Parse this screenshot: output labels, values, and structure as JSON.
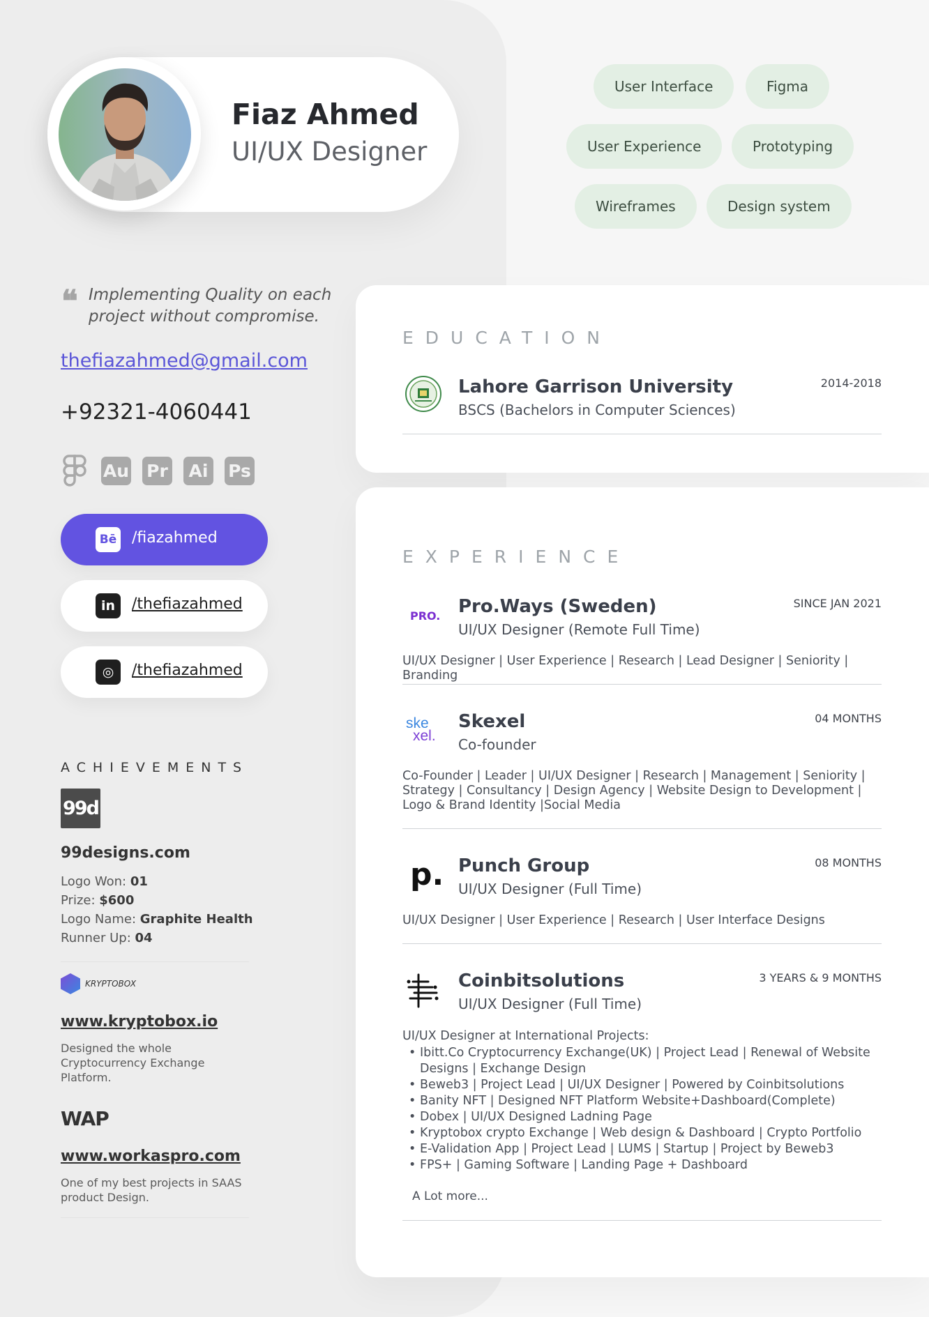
{
  "profile": {
    "name": "Fiaz Ahmed",
    "title": "UI/UX Designer",
    "quote": "Implementing Quality on each project without compromise.",
    "email": "thefiazahmed@gmail.com",
    "phone": "+92321-4060441"
  },
  "skills": [
    "User Interface",
    "Figma",
    "User Experience",
    "Prototyping",
    "Wireframes",
    "Design system"
  ],
  "tools": [
    {
      "icon": "figma-icon",
      "label": ""
    },
    {
      "icon": "audition-icon",
      "label": "Au"
    },
    {
      "icon": "premiere-icon",
      "label": "Pr"
    },
    {
      "icon": "illustrator-icon",
      "label": "Ai"
    },
    {
      "icon": "photoshop-icon",
      "label": "Ps"
    }
  ],
  "social": [
    {
      "icon": "behance-icon",
      "glyph": "Bē",
      "label": "/fiazahmed"
    },
    {
      "icon": "linkedin-icon",
      "glyph": "in",
      "label": "/thefiazahmed"
    },
    {
      "icon": "instagram-icon",
      "glyph": "◎",
      "label": "/thefiazahmed"
    }
  ],
  "achievements": {
    "title": "ACHIEVEMENTS",
    "designs99": {
      "logo_text": "99d",
      "site": "99designs.com",
      "lines": [
        {
          "label": "Logo Won: ",
          "value": "01"
        },
        {
          "label": "Prize: ",
          "value": "$600"
        },
        {
          "label": "Logo Name: ",
          "value": "Graphite Health"
        },
        {
          "label": "Runner Up: ",
          "value": "04"
        }
      ]
    },
    "kryptobox": {
      "logo_text": "KRYPTOBOX",
      "site": "www.kryptobox.io",
      "desc": "Designed the whole Cryptocurrency Exchange Platform."
    },
    "workaspro": {
      "logo_text": "WAP",
      "site": "www.workaspro.com",
      "desc": "One of my best projects in SAAS product Design."
    }
  },
  "education": {
    "title": "EDUCATION",
    "school": "Lahore Garrison University",
    "degree": "BSCS (Bachelors in Computer Sciences)",
    "years": "2014-2018"
  },
  "experience": {
    "title": "EXPERIENCE",
    "entries": [
      {
        "logo": "PRO.",
        "company": "Pro.Ways (Sweden)",
        "role": "UI/UX Designer (Remote Full Time)",
        "duration": "SINCE JAN 2021",
        "desc": "UI/UX Designer | User Experience | Research | Lead Designer | Seniority | Branding"
      },
      {
        "logo": "ske xel.",
        "company": "Skexel",
        "role": "Co-founder",
        "duration": "04 MONTHS",
        "desc": "Co-Founder | Leader | UI/UX Designer | Research | Management | Seniority | Strategy | Consultancy | Design Agency | Website Design to Development | Logo & Brand Identity |Social Media"
      },
      {
        "logo": "p.",
        "company": "Punch Group",
        "role": "UI/UX Designer (Full Time)",
        "duration": "08 MONTHS",
        "desc": "UI/UX Designer | User Experience | Research | User Interface Designs"
      },
      {
        "logo": "coinbit",
        "company": "Coinbitsolutions",
        "role": "UI/UX Designer (Full Time)",
        "duration": "3 YEARS & 9 MONTHS",
        "intro": "UI/UX Designer at International Projects:",
        "bullets": [
          "Ibitt.Co Cryptocurrency Exchange(UK) | Project Lead | Renewal of Website Designs | Exchange Design",
          "Beweb3 | Project Lead | UI/UX  Designer | Powered by Coinbitsolutions",
          "Banity NFT | Designed NFT Platform Website+Dashboard(Complete)",
          "Dobex | UI/UX Designed Ladning Page",
          "Kryptobox crypto Exchange | Web design & Dashboard | Crypto Portfolio",
          "E-Validation App | Project Lead | LUMS | Startup | Project by Beweb3",
          "FPS+ | Gaming Software | Landing Page + Dashboard"
        ],
        "more": "A Lot more..."
      }
    ]
  },
  "colors": {
    "accent": "#6253e1",
    "tag_bg": "#e3efe4",
    "left_panel": "#ededed",
    "tool_grey": "#a9a9a9"
  }
}
